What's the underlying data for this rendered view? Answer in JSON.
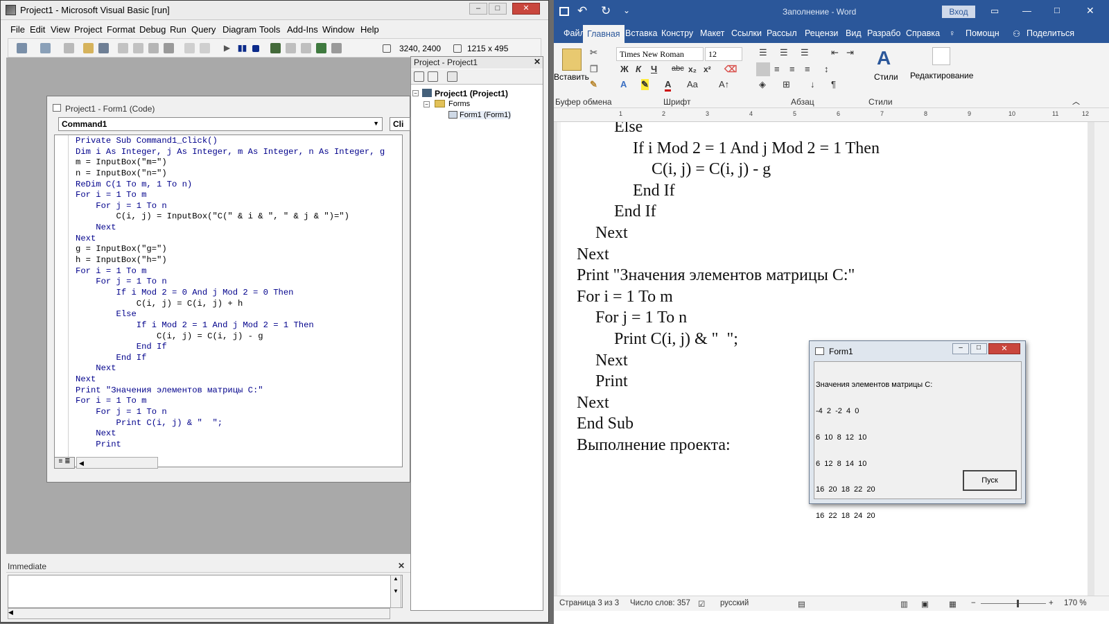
{
  "vb": {
    "title": "Project1 - Microsoft Visual Basic [run]",
    "menu": [
      "File",
      "Edit",
      "View",
      "Project",
      "Format",
      "Debug",
      "Run",
      "Query",
      "Diagram",
      "Tools",
      "Add-Ins",
      "Window",
      "Help"
    ],
    "coords": "3240, 2400",
    "size": "1215 x 495",
    "code_window_title": "Project1 - Form1 (Code)",
    "object_combo": "Command1",
    "proc_combo": "Cli",
    "code_lines": [
      {
        "indent": 0,
        "text": "Private Sub Command1_Click()",
        "kw": true
      },
      {
        "indent": 0,
        "text": "Dim i As Integer, j As Integer, m As Integer, n As Integer, g",
        "kw": true
      },
      {
        "indent": 0,
        "text": "m = InputBox(\"m=\")",
        "kw": false
      },
      {
        "indent": 0,
        "text": "n = InputBox(\"n=\")",
        "kw": false
      },
      {
        "indent": 0,
        "text": "ReDim C(1 To m, 1 To n)",
        "kw": true
      },
      {
        "indent": 0,
        "text": "For i = 1 To m",
        "kw": true
      },
      {
        "indent": 1,
        "text": "For j = 1 To n",
        "kw": true
      },
      {
        "indent": 2,
        "text": "C(i, j) = InputBox(\"C(\" & i & \", \" & j & \")=\")",
        "kw": false
      },
      {
        "indent": 1,
        "text": "Next",
        "kw": true
      },
      {
        "indent": 0,
        "text": "Next",
        "kw": true
      },
      {
        "indent": 0,
        "text": "g = InputBox(\"g=\")",
        "kw": false
      },
      {
        "indent": 0,
        "text": "h = InputBox(\"h=\")",
        "kw": false
      },
      {
        "indent": 0,
        "text": "For i = 1 To m",
        "kw": true
      },
      {
        "indent": 1,
        "text": "For j = 1 To n",
        "kw": true
      },
      {
        "indent": 2,
        "text": "If i Mod 2 = 0 And j Mod 2 = 0 Then",
        "kw": true
      },
      {
        "indent": 3,
        "text": "C(i, j) = C(i, j) + h",
        "kw": false
      },
      {
        "indent": 2,
        "text": "Else",
        "kw": true
      },
      {
        "indent": 3,
        "text": "If i Mod 2 = 1 And j Mod 2 = 1 Then",
        "kw": true
      },
      {
        "indent": 4,
        "text": "C(i, j) = C(i, j) - g",
        "kw": false
      },
      {
        "indent": 3,
        "text": "End If",
        "kw": true
      },
      {
        "indent": 2,
        "text": "End If",
        "kw": true
      },
      {
        "indent": 1,
        "text": "Next",
        "kw": true
      },
      {
        "indent": 0,
        "text": "Next",
        "kw": true
      },
      {
        "indent": 0,
        "text": "Print \"Значения элементов матрицы C:\"",
        "kw": true
      },
      {
        "indent": 0,
        "text": "For i = 1 To m",
        "kw": true
      },
      {
        "indent": 1,
        "text": "For j = 1 To n",
        "kw": true
      },
      {
        "indent": 2,
        "text": "Print C(i, j) & \"  \";",
        "kw": true
      },
      {
        "indent": 1,
        "text": "Next",
        "kw": true
      },
      {
        "indent": 1,
        "text": "Print",
        "kw": true
      }
    ],
    "project_header": "Project - Project1",
    "tree": {
      "root": "Project1 (Project1)",
      "forms": "Forms",
      "form": "Form1 (Form1)"
    },
    "immediate": "Immediate"
  },
  "word": {
    "title": "Заполнение - Word",
    "signin": "Вход",
    "tabs": [
      "Файл",
      "Главная",
      "Вставка",
      "Конструктор",
      "Макет",
      "Ссылки",
      "Рассылки",
      "Рецензирование",
      "Вид",
      "Разработчик",
      "Справка"
    ],
    "tab_labels": [
      "Файл",
      "Главная",
      "Вставка",
      "Констру",
      "Макет",
      "Ссылки",
      "Рассыл",
      "Рецензи",
      "Вид",
      "Разрабо",
      "Справка"
    ],
    "help": "Помощн",
    "share": "Поделиться",
    "ribbon": {
      "paste": "Вставить",
      "font_name": "Times New Roman",
      "font_size": "12",
      "styles": "Стили",
      "editing": "Редактирование",
      "groups": [
        "Буфер обмена",
        "Шрифт",
        "Абзац",
        "Стили"
      ]
    },
    "doc_lines": [
      {
        "indent": 2,
        "text": "Else"
      },
      {
        "indent": 3,
        "text": "If i Mod 2 = 1 And j Mod 2 = 1 Then"
      },
      {
        "indent": 4,
        "text": "C(i, j) = C(i, j) - g"
      },
      {
        "indent": 3,
        "text": "End If"
      },
      {
        "indent": 2,
        "text": "End If"
      },
      {
        "indent": 1,
        "text": "Next"
      },
      {
        "indent": 0,
        "text": "Next"
      },
      {
        "indent": 0,
        "text": "Print \"Значения элементов матрицы C:\""
      },
      {
        "indent": 0,
        "text": "For i = 1 To m"
      },
      {
        "indent": 1,
        "text": "For j = 1 To n"
      },
      {
        "indent": 2,
        "text": "Print C(i, j) & \"  \";"
      },
      {
        "indent": 1,
        "text": "Next"
      },
      {
        "indent": 1,
        "text": "Print"
      },
      {
        "indent": 0,
        "text": "Next"
      },
      {
        "indent": 0,
        "text": "End Sub"
      },
      {
        "indent": 0,
        "text": "Выполнение проекта:"
      }
    ],
    "status": {
      "page": "Страница 3 из 3",
      "words": "Число слов: 357",
      "lang": "русский",
      "zoom": "170 %"
    }
  },
  "form1": {
    "title": "Form1",
    "output": [
      "Значения элементов матрицы С:",
      "-4  2  -2  4  0",
      "6  10  8  12  10",
      "6  12  8  14  10",
      "16  20  18  22  20",
      "16  22  18  24  20"
    ],
    "button": "Пуск"
  }
}
